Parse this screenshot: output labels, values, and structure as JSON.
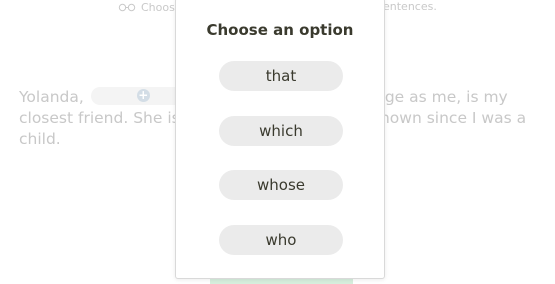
{
  "instructions": {
    "left_text": "Choos",
    "right_text": "entences."
  },
  "sentence": {
    "line1_start": "Yolanda,",
    "line1_end": "lege as me, is my",
    "line2_start": "closest friend. She is s",
    "line2_end": "known since I was a",
    "line3": "child."
  },
  "popover": {
    "title": "Choose an option",
    "options": [
      "that",
      "which",
      "whose",
      "who"
    ]
  },
  "colors": {
    "option_bg": "#ebebeb",
    "text_dark": "#3a3a2e",
    "faded_text": "#c8c8c8",
    "check_bar": "#d6eedd"
  }
}
